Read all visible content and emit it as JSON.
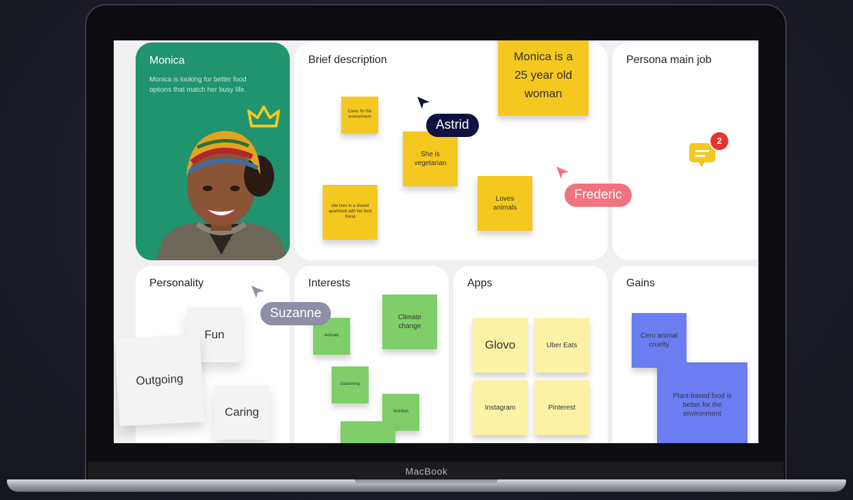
{
  "device": {
    "brand": "MacBook"
  },
  "persona": {
    "name": "Monica",
    "description": "Monica is looking for better food options that match her busy life."
  },
  "brief": {
    "title": "Brief description",
    "notes": [
      "Cares for the environment",
      "She is vegetarian",
      "she lives in a shared apartment with her best friend",
      "Loves animals",
      "Monica is a 25 year old woman"
    ]
  },
  "job": {
    "title": "Persona main job",
    "comment_count": "2"
  },
  "personality": {
    "title": "Personality",
    "notes": [
      "Fun",
      "Outgoing",
      "Caring"
    ]
  },
  "interests": {
    "title": "Interests",
    "notes": [
      "Animals",
      "Climate change",
      "Gardening",
      "Nutrition"
    ]
  },
  "apps": {
    "title": "Apps",
    "notes": [
      "Glovo",
      "Uber Eats",
      "Instagram",
      "Pinterest"
    ]
  },
  "gains": {
    "title": "Gains",
    "notes": [
      "Cero animal cruelty",
      "Plant-based food is better for the environment"
    ]
  },
  "cursors": [
    {
      "name": "Astrid",
      "color": "#0f1240"
    },
    {
      "name": "Frederic",
      "color": "#f1737d"
    },
    {
      "name": "Suzanne",
      "color": "#8e8ea6"
    }
  ],
  "colors": {
    "persona": "#20936f",
    "sticky_yellow": "#f4c81f",
    "sticky_green": "#7fce6a",
    "sticky_blue": "#6b7df1",
    "badge": "#e63232"
  }
}
